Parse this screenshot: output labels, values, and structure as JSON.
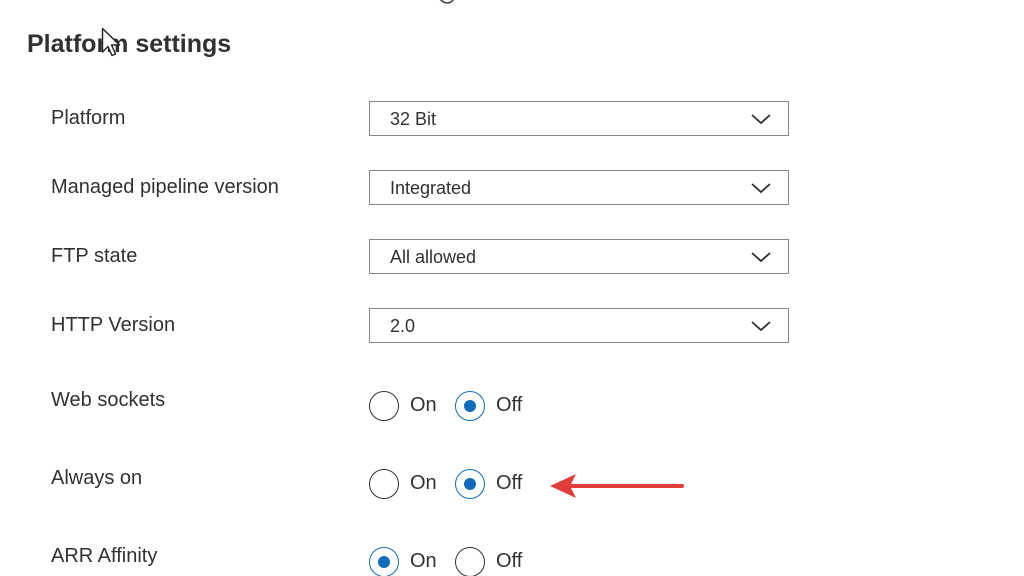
{
  "section": {
    "title": "Platform settings"
  },
  "rows": [
    {
      "label": "Platform",
      "type": "dropdown",
      "value": "32 Bit"
    },
    {
      "label": "Managed pipeline version",
      "type": "dropdown",
      "value": "Integrated"
    },
    {
      "label": "FTP state",
      "type": "dropdown",
      "value": "All allowed"
    },
    {
      "label": "HTTP Version",
      "type": "dropdown",
      "value": "2.0"
    },
    {
      "label": "Web sockets",
      "type": "radio",
      "options": [
        "On",
        "Off"
      ],
      "selected": "Off"
    },
    {
      "label": "Always on",
      "type": "radio",
      "options": [
        "On",
        "Off"
      ],
      "selected": "Off"
    },
    {
      "label": "ARR Affinity",
      "type": "radio",
      "options": [
        "On",
        "Off"
      ],
      "selected": "On"
    }
  ],
  "icons": {
    "dropdown": "chevron-down-icon",
    "annotation": "red-arrow-icon",
    "pointer": "mouse-pointer-icon"
  },
  "colors": {
    "accent": "#0f6cbd",
    "annotation": "#e03c3c",
    "text": "#323130",
    "border": "#8a8886"
  }
}
